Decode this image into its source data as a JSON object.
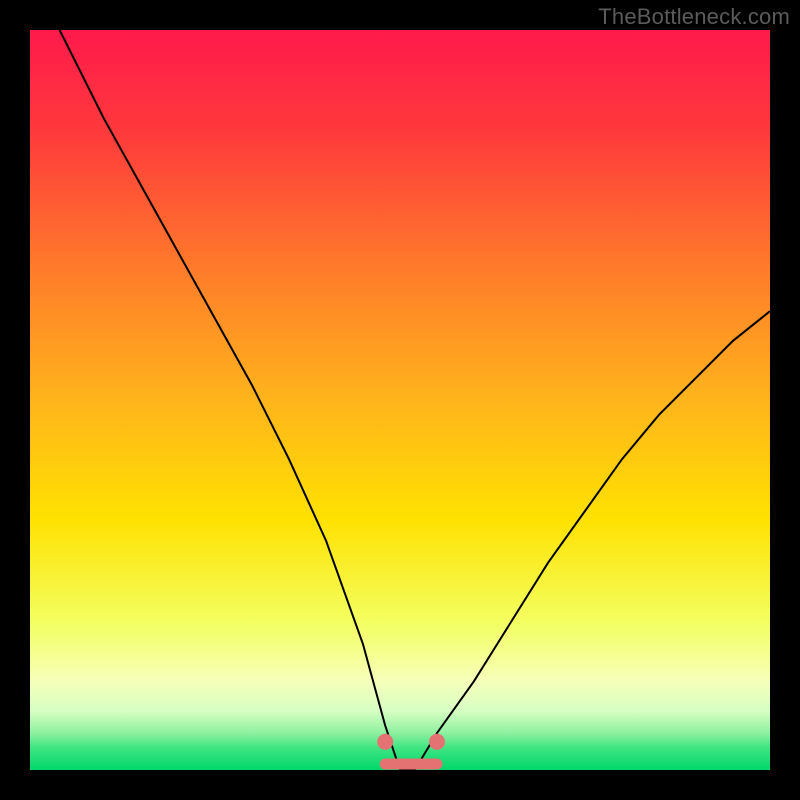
{
  "watermark": "TheBottleneck.com",
  "colors": {
    "frame": "#000000",
    "top": "#ff1a4b",
    "mid": "#ffdd00",
    "pale": "#f6ffba",
    "green": "#00e060",
    "curve": "#000000",
    "accent": "#e47272"
  },
  "chart_data": {
    "type": "line",
    "title": "",
    "xlabel": "",
    "ylabel": "",
    "xlim": [
      0,
      100
    ],
    "ylim": [
      0,
      100
    ],
    "description": "V-shaped bottleneck curve on rainbow gradient; minimum near x≈50. Axes have no numeric tick labels.",
    "series": [
      {
        "name": "curve",
        "x": [
          4,
          10,
          15,
          20,
          25,
          30,
          35,
          40,
          45,
          48,
          50,
          52,
          55,
          60,
          65,
          70,
          75,
          80,
          85,
          90,
          95,
          100
        ],
        "y": [
          100,
          88,
          79,
          70,
          61,
          52,
          42,
          31,
          17,
          6,
          0,
          0,
          5,
          12,
          20,
          28,
          35,
          42,
          48,
          53,
          58,
          62
        ]
      }
    ],
    "flat_segment": {
      "x_start": 48,
      "x_end": 55,
      "y": 0
    },
    "highlight_dots": [
      {
        "x": 48,
        "y": 3
      },
      {
        "x": 55,
        "y": 3
      }
    ]
  }
}
